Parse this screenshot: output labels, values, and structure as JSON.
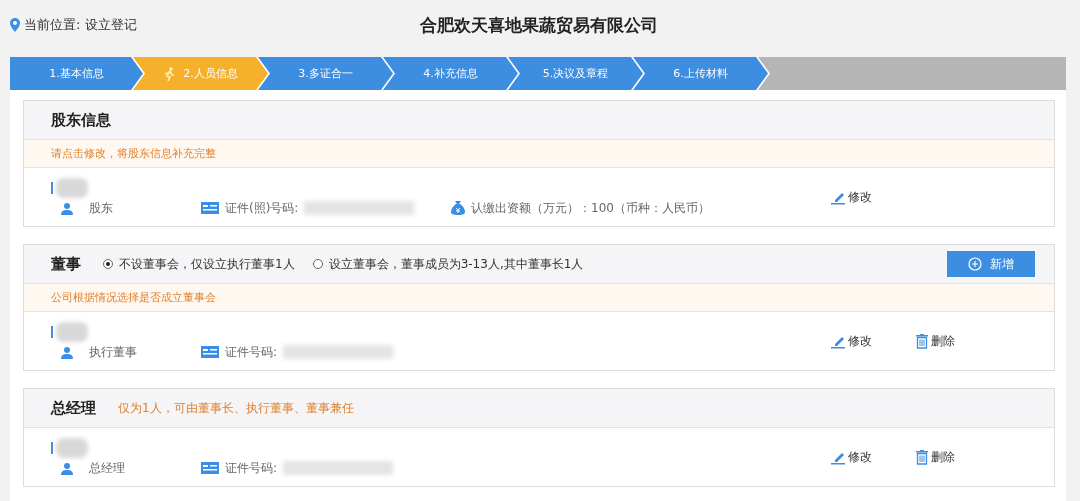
{
  "location": "当前位置: 设立登记",
  "title": "合肥欢天喜地果蔬贸易有限公司",
  "steps": [
    {
      "label": "1.基本信息",
      "selected": false
    },
    {
      "label": "2.人员信息",
      "selected": true
    },
    {
      "label": "3.多证合一",
      "selected": false
    },
    {
      "label": "4.补充信息",
      "selected": false
    },
    {
      "label": "5.决议及章程",
      "selected": false
    },
    {
      "label": "6.上传材料",
      "selected": false
    }
  ],
  "sections": [
    {
      "title": "股东信息",
      "notice": "请点击修改，将股东信息补充完整",
      "entries": [
        {
          "role": "股东",
          "id_label": "证件(照)号码:",
          "capital": "认缴出资额（万元）：100（币种：人民币）",
          "actions": [
            {
              "kind": "edit",
              "label": "修改"
            }
          ]
        }
      ]
    },
    {
      "title": "董事",
      "options": [
        {
          "label": "不设董事会，仅设立执行董事1人",
          "selected": true
        },
        {
          "label": "设立董事会，董事成员为3-13人,其中董事长1人",
          "selected": false
        }
      ],
      "add_button": "新增",
      "notice": "公司根据情况选择是否成立董事会",
      "entries": [
        {
          "role": "执行董事",
          "id_label": "证件号码:",
          "actions": [
            {
              "kind": "edit",
              "label": "修改"
            },
            {
              "kind": "delete",
              "label": "删除"
            }
          ]
        }
      ]
    },
    {
      "title": "总经理",
      "note": "仅为1人，可由董事长、执行董事、董事兼任",
      "entries": [
        {
          "role": "总经理",
          "id_label": "证件号码:",
          "actions": [
            {
              "kind": "edit",
              "label": "修改"
            },
            {
              "kind": "delete",
              "label": "删除"
            }
          ]
        }
      ]
    }
  ]
}
